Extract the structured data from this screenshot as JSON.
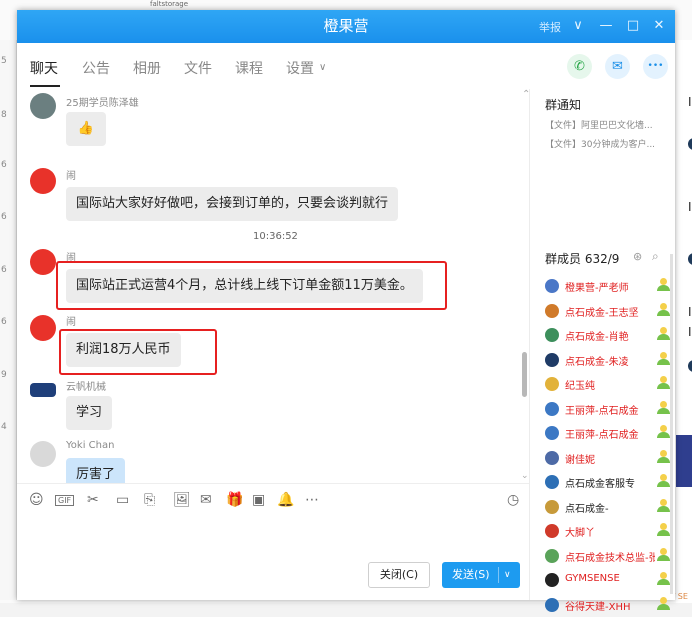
{
  "background": {
    "left_marks": [
      "5",
      "8",
      "6",
      "6",
      "6",
      "6",
      "9",
      "4"
    ],
    "right_letters": [
      "I",
      "I",
      "I",
      "I",
      "I"
    ],
    "top_text": "faltstorage",
    "bottom_text": "HOT SE"
  },
  "window": {
    "title": "橙果营",
    "report_label": "举报",
    "controls": {
      "down": "∨",
      "min": "—",
      "max": "□",
      "close": "✕"
    }
  },
  "tabs": [
    {
      "label": "聊天"
    },
    {
      "label": "公告"
    },
    {
      "label": "相册"
    },
    {
      "label": "文件"
    },
    {
      "label": "课程"
    },
    {
      "label": "设置"
    }
  ],
  "settings_chevron": "∨",
  "header_icons": {
    "phone": "✆",
    "share": "✉",
    "more": "•••"
  },
  "chat": {
    "messages": [
      {
        "sender": "25期学员陈泽雄",
        "text": "👍"
      },
      {
        "sender": "闹",
        "text": "国际站大家好好做吧，会接到订单的，只要会谈判就行"
      },
      {
        "sender": "闹",
        "text": "国际站正式运营4个月，总计线上线下订单金额11万美金。"
      },
      {
        "sender": "闹",
        "text": "利润18万人民币"
      },
      {
        "sender": "云帆机械",
        "text": "学习"
      },
      {
        "sender": "Yoki Chan",
        "text": "厉害了"
      }
    ],
    "timestamp": "10:36:52"
  },
  "toolbar_icons": [
    "☺",
    "GIF",
    "✂",
    "▭",
    "⎘",
    "🖼",
    "✉",
    "🎁",
    "▣",
    "🔔",
    "⋯"
  ],
  "history_icon": "◷",
  "buttons": {
    "close": "关闭(C)",
    "send": "发送(S)",
    "send_dropdown": "∨"
  },
  "side": {
    "notice_title": "群通知",
    "notices": [
      "【文件】阿里巴巴文化墙...",
      "【文件】30分钟成为客户..."
    ],
    "members_title": "群成员",
    "members_count": "632/9",
    "members": [
      {
        "name": "橙果营-严老师",
        "color": "#e02020"
      },
      {
        "name": "点石成金-王志坚",
        "color": "#e02020"
      },
      {
        "name": "点石成金-肖艳",
        "color": "#e02020"
      },
      {
        "name": "点石成金-朱凌",
        "color": "#e02020"
      },
      {
        "name": "纪玉纯",
        "color": "#e02020"
      },
      {
        "name": "王丽萍-点石成金",
        "color": "#e02020"
      },
      {
        "name": "王丽萍-点石成金",
        "color": "#e02020"
      },
      {
        "name": "谢佳妮",
        "color": "#e02020"
      },
      {
        "name": "点石成金客服专",
        "color": "#222222"
      },
      {
        "name": "点石成金-",
        "color": "#222222"
      },
      {
        "name": "大脚丫",
        "color": "#e02020"
      },
      {
        "name": "点石成金技术总监-张",
        "color": "#e02020"
      },
      {
        "name": "GYMSENSE",
        "color": "#e02020"
      },
      {
        "name": "谷得天建-XHH",
        "color": "#e02020"
      }
    ]
  }
}
